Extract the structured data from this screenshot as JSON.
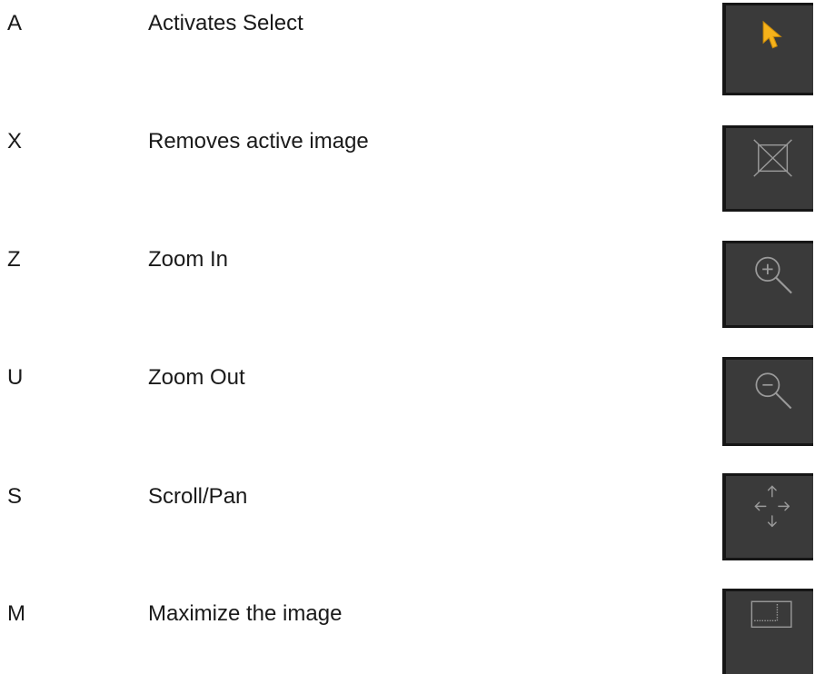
{
  "shortcuts": [
    {
      "key": "A",
      "description": "Activates Select",
      "icon": "select-arrow-icon"
    },
    {
      "key": "X",
      "description": "Removes active image",
      "icon": "remove-image-icon"
    },
    {
      "key": "Z",
      "description": "Zoom In",
      "icon": "zoom-in-icon"
    },
    {
      "key": "U",
      "description": "Zoom Out",
      "icon": "zoom-out-icon"
    },
    {
      "key": "S",
      "description": "Scroll/Pan",
      "icon": "scroll-pan-icon"
    },
    {
      "key": "M",
      "description": "Maximize the image",
      "icon": "maximize-icon"
    }
  ],
  "colors": {
    "tile_background": "#3a3a3a",
    "tile_border": "#161616",
    "icon_stroke": "#9a9a9a",
    "select_accent": "#f6b21a"
  }
}
